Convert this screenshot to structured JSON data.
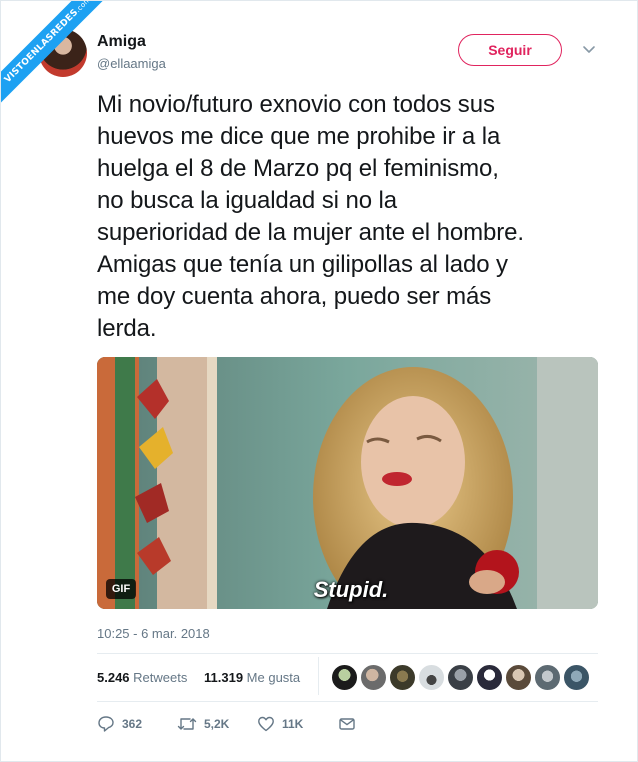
{
  "watermark": {
    "text": "VISTOENLASREDES",
    "sub": ".com"
  },
  "author": {
    "name": "Amiga",
    "handle": "@ellaamiga"
  },
  "follow_label": "Seguir",
  "tweet_text": "Mi novio/futuro exnovio con todos sus\nhuevos me dice que me prohibe ir a la\nhuelga el 8 de Marzo pq el feminismo,\nno busca la igualdad si no la\nsuperioridad de la mujer ante el hombre.\nAmigas que tenía un gilipollas al lado y\nme doy cuenta ahora, puedo ser más\nlerda.",
  "media": {
    "badge": "GIF",
    "caption": "Stupid."
  },
  "timestamp": "10:25 - 6 mar. 2018",
  "stats": {
    "retweets_count": "5.246",
    "retweets_label": "Retweets",
    "likes_count": "11.319",
    "likes_label": "Me gusta"
  },
  "actions": {
    "replies": "362",
    "retweets": "5,2K",
    "likes": "11K"
  },
  "colors": {
    "accent": "#1da1f2",
    "follow": "#e0245e",
    "muted": "#657786"
  }
}
